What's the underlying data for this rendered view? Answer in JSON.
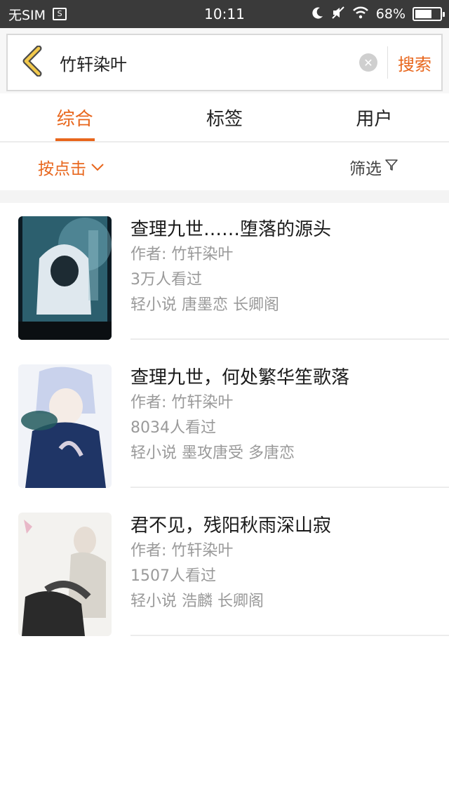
{
  "status_bar": {
    "carrier": "无SIM",
    "sim_icon_text": "S",
    "time": "10:11",
    "battery": "68%",
    "battery_level": 0.68
  },
  "search": {
    "query": "竹轩染叶",
    "search_label": "搜索"
  },
  "tabs": [
    {
      "label": "综合",
      "active": true
    },
    {
      "label": "标签",
      "active": false
    },
    {
      "label": "用户",
      "active": false
    }
  ],
  "filter": {
    "sort_label": "按点击",
    "filter_label": "筛选"
  },
  "colors": {
    "accent": "#e8661c",
    "status_bar": "#3a3a3a",
    "back_arrow": "#f2c94c"
  },
  "results": [
    {
      "title": "查理九世……堕落的源头",
      "author": "作者: 竹轩染叶",
      "views": "3万人看过",
      "tags": "轻小说  唐墨恋  长卿阁"
    },
    {
      "title": "查理九世，何处繁华笙歌落",
      "author": "作者: 竹轩染叶",
      "views": "8034人看过",
      "tags": "轻小说  墨攻唐受  多唐恋"
    },
    {
      "title": "君不见，残阳秋雨深山寂",
      "author": "作者: 竹轩染叶",
      "views": "1507人看过",
      "tags": "轻小说  浩麟  长卿阁"
    }
  ]
}
